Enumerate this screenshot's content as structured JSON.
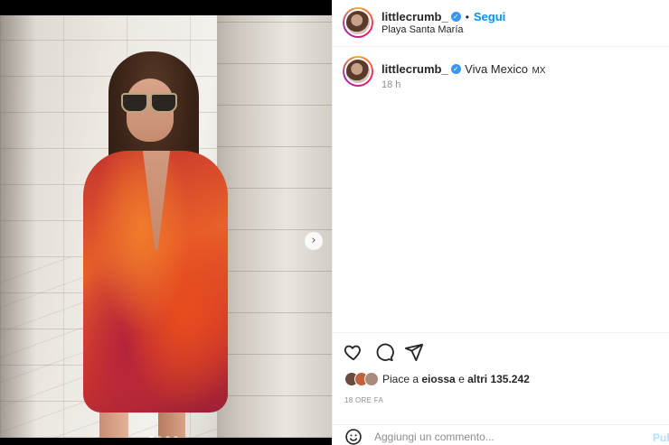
{
  "post": {
    "username": "littlecrumb_",
    "follow_label": "Segui",
    "location": "Playa Santa María",
    "separator": "•"
  },
  "caption": {
    "username": "littlecrumb_",
    "text": "Viva Mexico",
    "country_code": "MX",
    "age": "18 h"
  },
  "media": {
    "next_glyph": "›",
    "carousel_count": 4,
    "carousel_active": 1
  },
  "engagement": {
    "likes_prefix": "Piace a",
    "liker": "eiossa",
    "likes_connector": "e",
    "others_label": "altri 135.242",
    "date": "18 ORE FA"
  },
  "comment": {
    "placeholder": "Aggiungi un commento...",
    "publish_label": "Pubblica"
  },
  "icons": {
    "like": "heart-icon",
    "comment": "comment-icon",
    "share": "paper-plane-icon",
    "emoji": "emoji-icon",
    "verified": "verified-badge-icon"
  },
  "colors": {
    "follow": "#0095f6",
    "verified": "#3897f0",
    "muted": "#8e8e8e"
  }
}
